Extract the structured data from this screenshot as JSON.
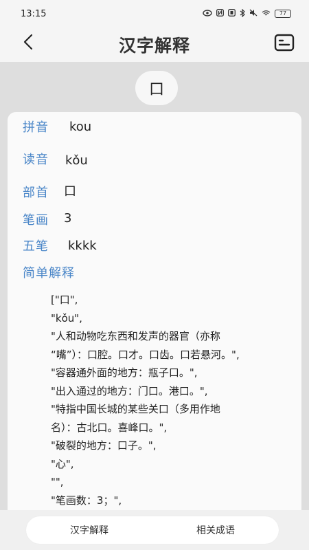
{
  "status": {
    "time": "13:15",
    "battery": "77"
  },
  "header": {
    "title": "汉字解释",
    "back_icon": "chevron-left-icon",
    "menu_icon": "card-list-icon"
  },
  "character": "口",
  "details": {
    "pinyin_label": "拼音",
    "pinyin": "kou",
    "reading_label": "读音",
    "reading": "kǒu",
    "radical_label": "部首",
    "radical": "口",
    "strokes_label": "笔画",
    "strokes": "3",
    "wubi_label": "五笔",
    "wubi": "kkkk",
    "explain_label": "简单解释"
  },
  "explanation_lines": [
    "[\"口\",",
    "\"kǒu\",",
    "\"人和动物吃东西和发声的器官（亦称",
    "“嘴”）：口腔。口才。口齿。口若悬河。\",",
    "\"容器通外面的地方：瓶子口。\",",
    "\"出入通过的地方：门口。港口。\",",
    "\"特指中国长城的某些关口（多用作地",
    "名）：古北口。喜峰口。\",",
    "\"破裂的地方：口子。\",",
    "\"心\",",
    "\"\",",
    "\"笔画数：3；\","
  ],
  "tabs": {
    "tab1": "汉字解释",
    "tab2": "相关成语"
  }
}
